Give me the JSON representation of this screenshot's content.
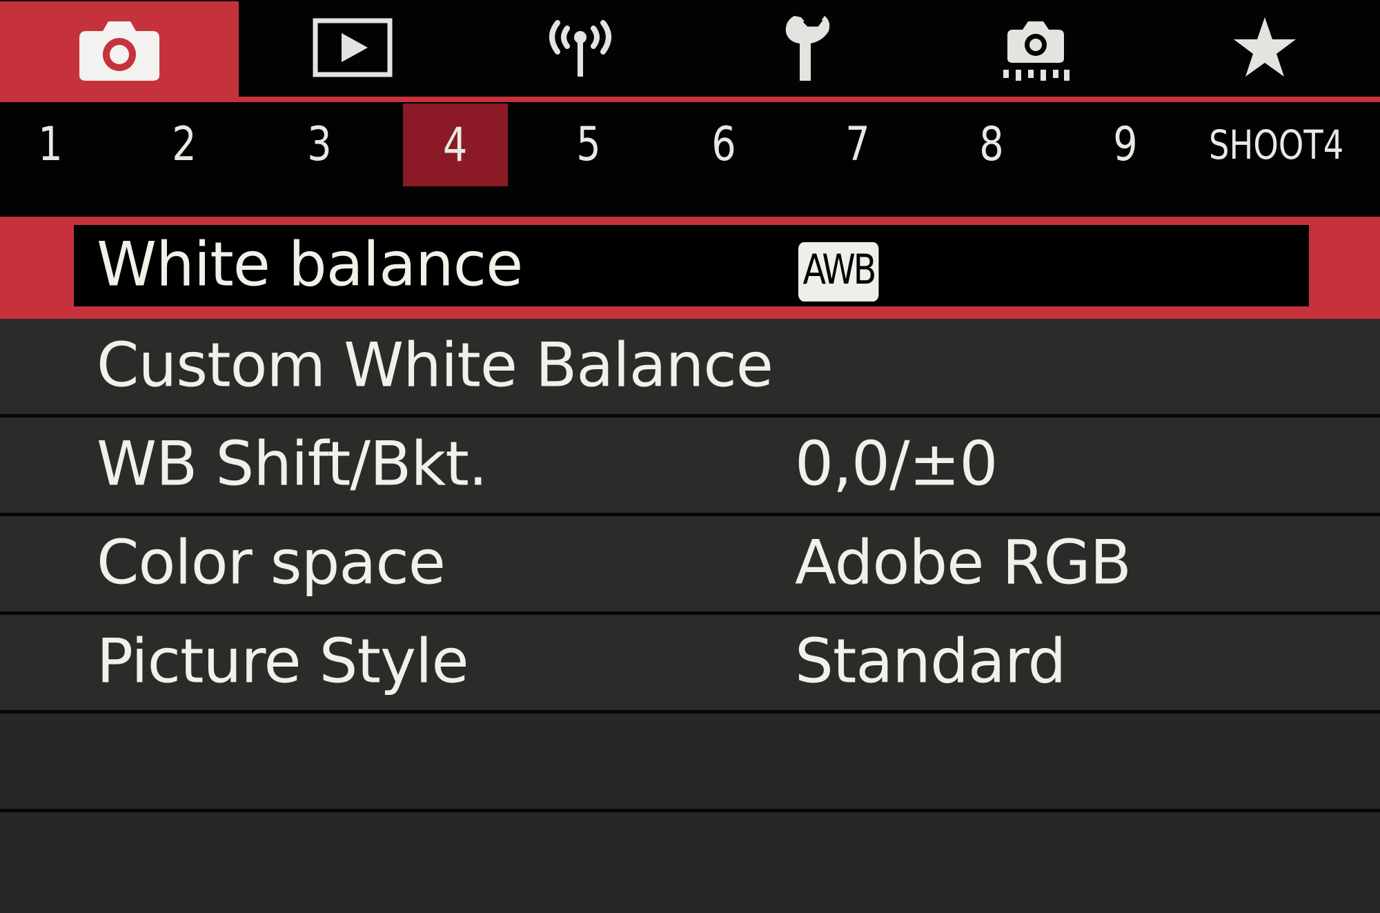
{
  "category_tabs": [
    {
      "id": "shoot",
      "icon": "camera-icon",
      "active": true
    },
    {
      "id": "playback",
      "icon": "playback-icon",
      "active": false
    },
    {
      "id": "wireless",
      "icon": "wireless-icon",
      "active": false
    },
    {
      "id": "setup",
      "icon": "wrench-icon",
      "active": false
    },
    {
      "id": "custom-functions",
      "icon": "custom-functions-camera-icon",
      "active": false
    },
    {
      "id": "my-menu",
      "icon": "star-icon",
      "active": false
    }
  ],
  "page_tabs": {
    "numbers": [
      "1",
      "2",
      "3",
      "4",
      "5",
      "6",
      "7",
      "8",
      "9"
    ],
    "active": "4",
    "label": "SHOOT4"
  },
  "menu_items": [
    {
      "label": "White balance",
      "value": "AWB",
      "value_is_badge": true,
      "selected": true
    },
    {
      "label": "Custom White Balance",
      "value": "",
      "value_is_badge": false,
      "selected": false
    },
    {
      "label": "WB Shift/Bkt.",
      "value": "0,0/±0",
      "value_is_badge": false,
      "selected": false
    },
    {
      "label": "Color space",
      "value": "Adobe RGB",
      "value_is_badge": false,
      "selected": false
    },
    {
      "label": "Picture Style",
      "value": "Standard",
      "value_is_badge": false,
      "selected": false
    }
  ],
  "colors": {
    "accent_red": "#c6323c",
    "active_page_red": "#8b1a26",
    "row_background": "#2a2c2a",
    "text": "#f1f1ea"
  }
}
